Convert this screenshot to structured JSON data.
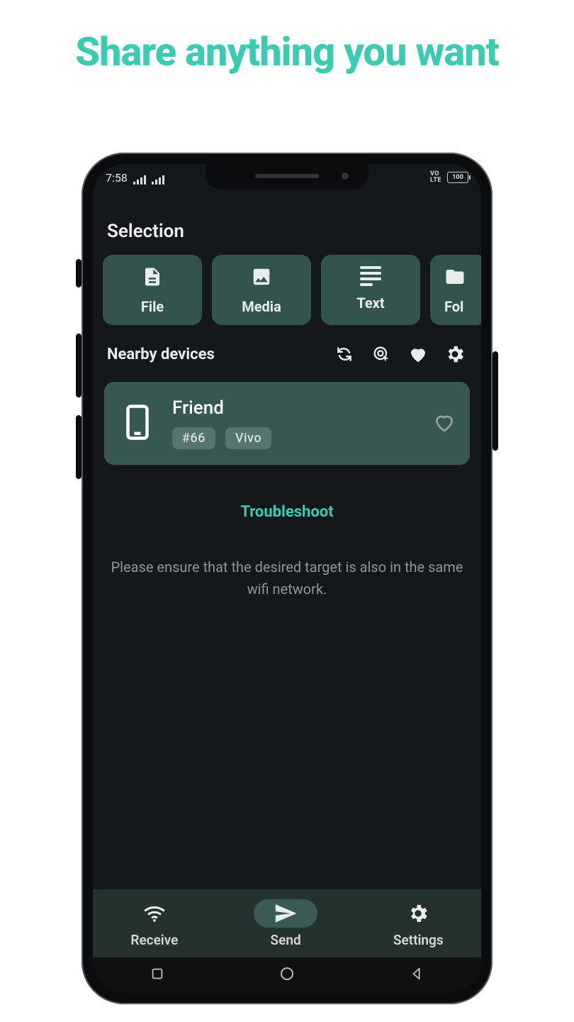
{
  "promo": {
    "title": "Share anything you want"
  },
  "status": {
    "time": "7:58",
    "battery": "100"
  },
  "section_title": "Selection",
  "chips": {
    "file": "File",
    "media": "Media",
    "text": "Text",
    "folder": "Fol"
  },
  "nearby": {
    "label": "Nearby devices"
  },
  "device": {
    "name": "Friend",
    "id_badge": "#66",
    "brand_badge": "Vivo"
  },
  "troubleshoot": "Troubleshoot",
  "hint": "Please ensure that the desired target is also in the same wifi network.",
  "tabs": {
    "receive": "Receive",
    "send": "Send",
    "settings": "Settings"
  }
}
